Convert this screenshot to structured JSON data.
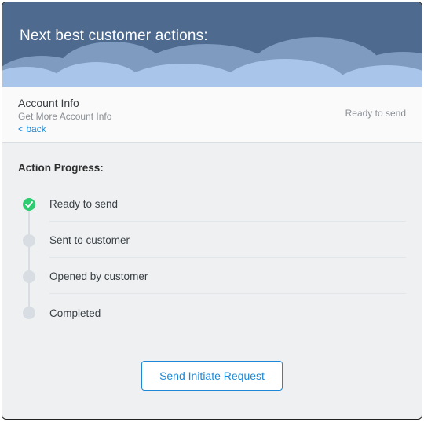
{
  "header": {
    "title": "Next best customer actions:"
  },
  "info": {
    "title": "Account Info",
    "subtitle": "Get More Account Info",
    "back_label": "< back",
    "status": "Ready to send"
  },
  "progress": {
    "section_title": "Action Progress:",
    "steps": [
      {
        "label": "Ready to send",
        "active": true
      },
      {
        "label": "Sent to customer",
        "active": false
      },
      {
        "label": "Opened by customer",
        "active": false
      },
      {
        "label": "Completed",
        "active": false
      }
    ]
  },
  "action": {
    "primary_button": "Send Initiate Request"
  },
  "colors": {
    "header_bg": "#4e6b8f",
    "cloud_light": "#a9c6ea",
    "cloud_lighter": "#d5e4f6",
    "accent": "#1e88d6",
    "success": "#2ecc71"
  }
}
